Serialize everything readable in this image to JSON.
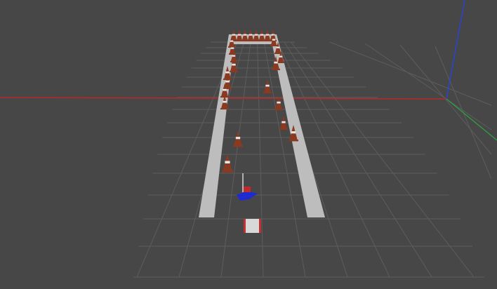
{
  "scene": {
    "background_color": "#474747",
    "grid_color": "#5d5d5d",
    "axis_x_color": "#b22a2a",
    "axis_y_color": "#2f9e44",
    "axis_z_color": "#2b45c8",
    "lane_line_color": "#bdbdbd",
    "cone_color": "#8a3a20",
    "cone_stripe_color": "#e7e7e7",
    "robot_color": "#1f2bcf",
    "car_color": "#d8d8d8",
    "car_accent_color": "#c23030"
  }
}
